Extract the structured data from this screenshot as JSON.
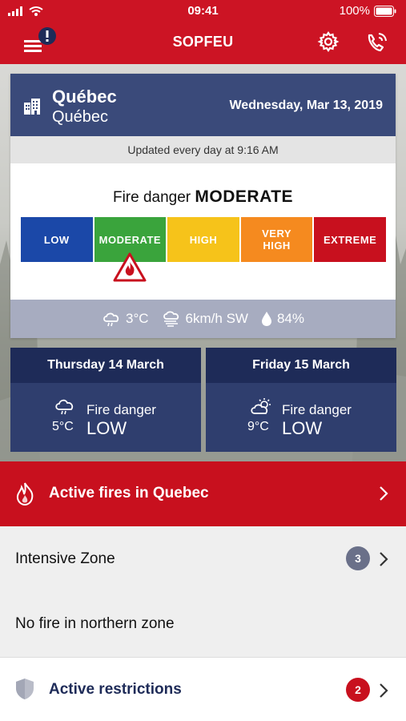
{
  "status_bar": {
    "time": "09:41",
    "battery": "100%"
  },
  "header": {
    "title": "SOPFEU"
  },
  "location": {
    "city": "Québec",
    "region": "Québec",
    "date": "Wednesday, Mar 13, 2019"
  },
  "updated_text": "Updated every day at 9:16 AM",
  "danger": {
    "prefix": "Fire danger",
    "level": "MODERATE",
    "current_index": 1,
    "scale": [
      {
        "label": "LOW",
        "color": "#1b48a8"
      },
      {
        "label": "MODERATE",
        "color": "#3aa43c"
      },
      {
        "label": "HIGH",
        "color": "#f6c31a"
      },
      {
        "label": "VERY\nHIGH",
        "color": "#f58a1f"
      },
      {
        "label": "EXTREME",
        "color": "#c8101e"
      }
    ]
  },
  "weather": {
    "temperature": "3°C",
    "wind": "6km/h SW",
    "humidity": "84%"
  },
  "forecast": [
    {
      "day": "Thursday 14 March",
      "label": "Fire danger",
      "level": "LOW",
      "temperature": "5°C",
      "icon": "cloud-rain-icon"
    },
    {
      "day": "Friday 15 March",
      "label": "Fire danger",
      "level": "LOW",
      "temperature": "9°C",
      "icon": "sun-cloud-icon"
    }
  ],
  "active_fires": {
    "label": "Active fires in Quebec"
  },
  "zones": [
    {
      "label": "Intensive Zone",
      "count": "3"
    },
    {
      "label": "No fire in northern zone"
    }
  ],
  "restrictions": {
    "label": "Active restrictions",
    "count": "2"
  },
  "colors": {
    "primary_red": "#cc1424",
    "navy": "#3a4a7a",
    "badge_gray": "#6a7089",
    "badge_red": "#c8101e"
  }
}
